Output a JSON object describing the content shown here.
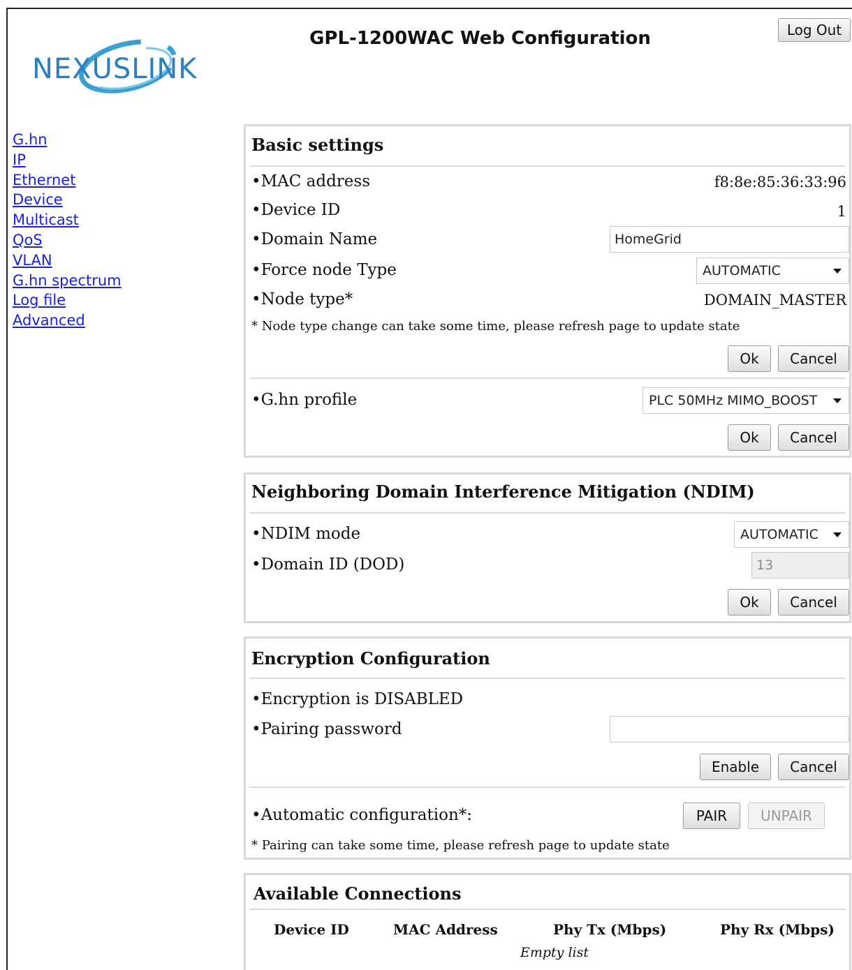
{
  "header": {
    "brand_name": "NEXUSLINK",
    "title": "GPL-1200WAC Web Configuration",
    "logout_label": "Log Out"
  },
  "nav": {
    "items": [
      "G.hn",
      "IP",
      "Ethernet",
      "Device",
      "Multicast",
      "QoS",
      "VLAN",
      "G.hn spectrum",
      "Log file",
      "Advanced"
    ]
  },
  "basic": {
    "title": "Basic settings",
    "mac_label": "•MAC address",
    "mac_value": "f8:8e:85:36:33:96",
    "device_id_label": "•Device ID",
    "device_id_value": "1",
    "domain_name_label": "•Domain Name",
    "domain_name_value": "HomeGrid",
    "force_node_label": "•Force node Type",
    "force_node_value": "AUTOMATIC",
    "node_type_label": "•Node type*",
    "node_type_value": "DOMAIN_MASTER",
    "note": "* Node type change can take some time, please refresh page to update state",
    "ok_label": "Ok",
    "cancel_label": "Cancel",
    "profile_label": "•G.hn profile",
    "profile_value": "PLC 50MHz MIMO_BOOST"
  },
  "ndim": {
    "title": "Neighboring Domain Interference Mitigation (NDIM)",
    "mode_label": "•NDIM mode",
    "mode_value": "AUTOMATIC",
    "domain_id_label": "•Domain ID (DOD)",
    "domain_id_value": "13",
    "ok_label": "Ok",
    "cancel_label": "Cancel"
  },
  "encryption": {
    "title": "Encryption Configuration",
    "status_label": "•Encryption is DISABLED",
    "password_label": "•Pairing password",
    "password_value": "",
    "enable_label": "Enable",
    "cancel_label": "Cancel",
    "auto_label": "•Automatic configuration*:",
    "pair_label": "PAIR",
    "unpair_label": "UNPAIR",
    "note": "* Pairing can take some time, please refresh page to update state"
  },
  "connections": {
    "title": "Available Connections",
    "columns": [
      "Device ID",
      "MAC Address",
      "Phy Tx (Mbps)",
      "Phy Rx (Mbps)"
    ],
    "empty_text": "Empty list"
  },
  "colors": {
    "link": "#1a22d6",
    "logo_text": "#2a7fc1",
    "logo_swoosh": "#3aa0d4",
    "panel_border": "#d9d9d9"
  },
  "icons": {
    "logo": "nexuslink-logo-swoosh",
    "dropdown": "chevron-down-icon"
  }
}
